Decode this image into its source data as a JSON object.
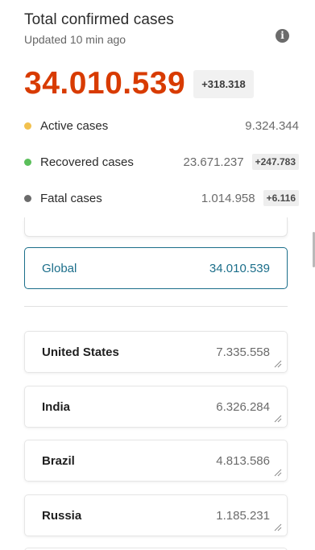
{
  "header": {
    "title": "Total confirmed cases",
    "updated": "Updated 10 min ago"
  },
  "summary": {
    "total": "34.010.539",
    "total_delta": "+318.318"
  },
  "stats": [
    {
      "label": "Active cases",
      "value": "9.324.344",
      "delta": "",
      "color": "#f2c14e"
    },
    {
      "label": "Recovered cases",
      "value": "23.671.237",
      "delta": "+247.783",
      "color": "#5bbf5b"
    },
    {
      "label": "Fatal cases",
      "value": "1.014.958",
      "delta": "+6.116",
      "color": "#6b6b6b"
    }
  ],
  "global": {
    "name": "Global",
    "value": "34.010.539"
  },
  "countries": [
    {
      "name": "United States",
      "value": "7.335.558"
    },
    {
      "name": "India",
      "value": "6.326.284"
    },
    {
      "name": "Brazil",
      "value": "4.813.586"
    },
    {
      "name": "Russia",
      "value": "1.185.231"
    }
  ],
  "colors": {
    "accent": "#d83b01",
    "global": "#1b6e8a"
  },
  "icons": {
    "info": "info-icon",
    "resize": "resize-handle-icon"
  }
}
